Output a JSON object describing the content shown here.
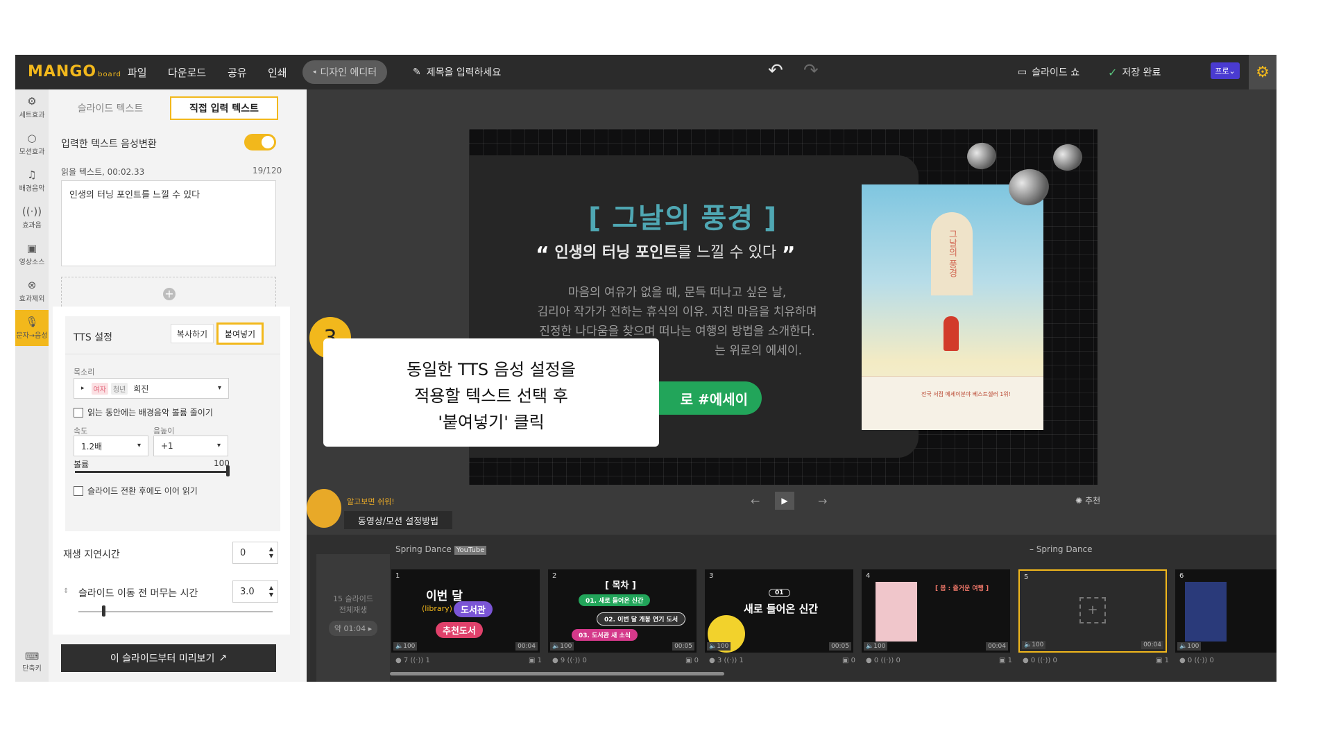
{
  "app": {
    "logo": "MANGO",
    "logo_sub": "board",
    "menu": [
      "파일",
      "다운로드",
      "공유",
      "인쇄"
    ],
    "design_editor": "디자인 에디터",
    "title_placeholder": "제목을 입력하세요",
    "slideshow": "슬라이드 쇼",
    "saved": "저장 완료",
    "pro": "프로"
  },
  "rail": [
    {
      "label": "세트효과",
      "icon": "gear-outline-icon"
    },
    {
      "label": "모션효과",
      "icon": "circle-icon"
    },
    {
      "label": "배경음악",
      "icon": "music-note-icon"
    },
    {
      "label": "효과음",
      "icon": "sound-wave-icon"
    },
    {
      "label": "영상소스",
      "icon": "film-icon"
    },
    {
      "label": "효과제외",
      "icon": "target-icon"
    },
    {
      "label": "문자→음성",
      "icon": "microphone-icon"
    }
  ],
  "rail_bottom": {
    "label": "단축키",
    "icon": "keyboard-icon"
  },
  "panel": {
    "tab_slide_text": "슬라이드 텍스트",
    "tab_direct_text": "직접 입력 텍스트",
    "tts_toggle_label": "입력한 텍스트 음성변환",
    "tts_toggle_on": true,
    "read_text_label": "읽을 텍스트, 00:02.33",
    "char_count": "19/120",
    "text_value": "인생의 터닝 포인트를 느낄 수 있다",
    "preview_button": "이 슬라이드부터 미리보기"
  },
  "tts": {
    "title": "TTS 설정",
    "copy": "복사하기",
    "paste": "붙여넣기",
    "voice_label": "목소리",
    "voice_tags": [
      "여자",
      "청년"
    ],
    "voice_name": "희진",
    "lower_bgm": "읽는 동안에는 배경음악 볼륨 줄이기",
    "speed_label": "속도",
    "speed_value": "1.2배",
    "pitch_label": "음높이",
    "pitch_value": "+1",
    "volume_label": "볼륨",
    "volume_value": "100",
    "volume_level": 1.0,
    "continue_reading": "슬라이드 전환 후에도 이어 읽기",
    "delay_label": "재생 지연시간",
    "delay_value": "0",
    "dwell_label": "슬라이드 이동 전 머무는 시간",
    "dwell_value": "3.0"
  },
  "slide": {
    "title": "[ 그날의 풍경 ]",
    "quote_open": "“",
    "quote_close": "”",
    "quote_bold": "인생의 터닝 포인트",
    "quote_rest": "를 느낄 수 있다",
    "body_lines": [
      "마음의 여유가 없을 때, 문득 떠나고 싶은  날,",
      "김리아 작가가 전하는 휴식의 이유. 지친 마음을 치유하며",
      "진정한 나다움을 찾으며 떠나는 여행의 방법을 소개한다.",
      "는 위로의 에세이."
    ],
    "hashtag": "로 #에세이",
    "book_title": "그날의 풍경",
    "book_footer": "전국 서점 에세이분야 베스트셀러 1위!"
  },
  "canvas_controls": {
    "prev": "←",
    "play": "▶",
    "next": "→",
    "recommend": "추천"
  },
  "mascot": {
    "tag": "알고보면 쉬워!",
    "howto": "동영상/모션 설정방법"
  },
  "filmstrip": {
    "all_play_line1": "15 슬라이드",
    "all_play_line2": "전체재생",
    "all_play_time": "약 01:04 ▸",
    "section1": "Spring Dance",
    "section1_badge": "YouTube",
    "section2": "– Spring Dance",
    "thumbs": [
      {
        "num": "1",
        "vol": "100",
        "dur": "00:04",
        "motions": "7",
        "sounds": "1",
        "clips": "1"
      },
      {
        "num": "2",
        "vol": "100",
        "dur": "00:05",
        "motions": "9",
        "sounds": "0",
        "clips": "0"
      },
      {
        "num": "3",
        "vol": "100",
        "dur": "00:05",
        "motions": "3",
        "sounds": "1",
        "clips": "0"
      },
      {
        "num": "4",
        "vol": "100",
        "dur": "00:04",
        "motions": "0",
        "sounds": "0",
        "clips": "1"
      },
      {
        "num": "5",
        "vol": "100",
        "dur": "00:04",
        "motions": "0",
        "sounds": "0",
        "clips": "1"
      },
      {
        "num": "6",
        "vol": "100",
        "dur": "",
        "motions": "0",
        "sounds": "0",
        "clips": ""
      }
    ],
    "t1_title": "이번 달",
    "t1_library": "(library)",
    "t1_pill": "도서관",
    "t1_pill2": "추천도서",
    "t2_title": "[ 목차 ]",
    "t2_items": [
      "01. 새로 들어온 신간",
      "02. 이번 달 개봉 연기 도서",
      "03. 도서관 새 소식"
    ],
    "t3_badge": "01",
    "t3_title": "새로 들어온 신간",
    "t4_title": "[ 봄 : 즐거운 여행 ]"
  },
  "callout": {
    "step": "3",
    "lines": [
      "동일한 TTS 음성 설정을",
      "적용할 텍스트 선택 후",
      "'붙여넣기' 클릭"
    ]
  },
  "colors": {
    "accent": "#f2b81c",
    "green": "#22a55a",
    "teal_title": "#4fa7b3",
    "pro_badge": "#4a3bd1"
  }
}
